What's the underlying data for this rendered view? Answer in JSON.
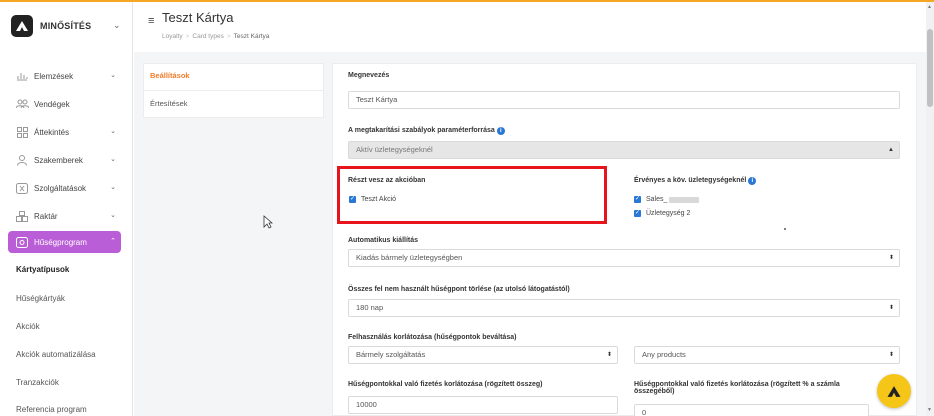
{
  "brand": {
    "name": "MINŐSÍTÉS"
  },
  "page": {
    "title": "Teszt Kártya"
  },
  "breadcrumb": [
    "Loyalty",
    "Card types",
    "Teszt Kártya"
  ],
  "sidebar": {
    "items": [
      {
        "label": "Elemzések",
        "icon": "chart-icon",
        "chevron": "⌄"
      },
      {
        "label": "Vendégek",
        "icon": "guests-icon",
        "chevron": ""
      },
      {
        "label": "Áttekintés",
        "icon": "grid-icon",
        "chevron": "⌄"
      },
      {
        "label": "Szakemberek",
        "icon": "person-icon",
        "chevron": "⌄"
      },
      {
        "label": "Szolgáltatások",
        "icon": "services-icon",
        "chevron": "⌄"
      },
      {
        "label": "Raktár",
        "icon": "warehouse-icon",
        "chevron": "⌄"
      },
      {
        "label": "Hűségprogram",
        "icon": "loyalty-icon",
        "chevron": "⌃"
      }
    ],
    "subitems": [
      "Kártyatípusok",
      "Hűségkártyák",
      "Akciók",
      "Akciók automatizálása",
      "Tranzakciók",
      "Referencia program"
    ]
  },
  "tabs": [
    "Beállítások",
    "Értesítések"
  ],
  "form": {
    "name_label": "Megnevezés",
    "name_value": "Teszt Kártya",
    "savings_label": "A megtakarítási szabályok paraméterforrása",
    "savings_value": "Aktív üzletegységeknél",
    "participates_label": "Részt vesz az akcióban",
    "participates_option": "Teszt Akció",
    "valid_label": "Érvényes a köv. üzletegységeknél",
    "valid_options": [
      "Sales_",
      "Üzletegység 2"
    ],
    "auto_issue_label": "Automatikus kiállítás",
    "auto_issue_value": "Kiadás bármely üzletegységben",
    "delete_points_label": "Összes fel nem használt hűségpont törlése (az utolsó látogatástól)",
    "delete_points_value": "180 nap",
    "usage_limit_label": "Felhasználás korlátozása (hűségpontok beváltása)",
    "usage_limit_service": "Bármely szolgáltatás",
    "usage_limit_products": "Any products",
    "fixed_limit_label": "Hűségpontokkal való fizetés korlátozása (rögzített összeg)",
    "fixed_limit_value": "10000",
    "percent_limit_label_1": "Hűségpontokkal való fizetés korlátozása (rögzített % a számla",
    "percent_limit_label_2": "összegéből)",
    "percent_limit_value": "0"
  },
  "colors": {
    "accent": "#b95ed6",
    "tab_active": "#f07d2a",
    "checkbox": "#2a78d6",
    "highlight": "#e8141c",
    "fab": "#f5c518"
  }
}
